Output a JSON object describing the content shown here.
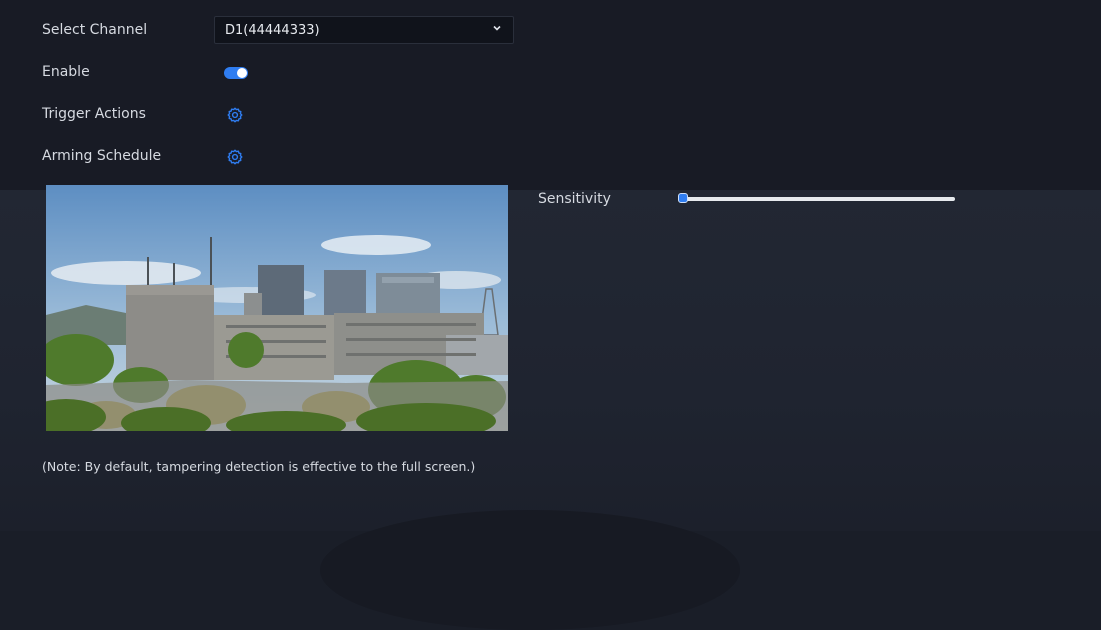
{
  "form": {
    "select_channel_label": "Select Channel",
    "channel_value": "D1(44444333)",
    "enable_label": "Enable",
    "enable_on": true,
    "trigger_actions_label": "Trigger Actions",
    "arming_schedule_label": "Arming Schedule"
  },
  "preview": {
    "image": "camera-live-view-city-buildings"
  },
  "sensitivity": {
    "label": "Sensitivity",
    "value_fraction": 0.01
  },
  "note": "(Note: By default, tampering detection is effective to the full screen.)",
  "icons": {
    "dropdown": "chevron-down-icon",
    "trigger_actions": "gear-icon",
    "arming_schedule": "gear-icon"
  },
  "colors": {
    "accent": "#2f7df1",
    "background_top": "#181b25",
    "background_bottom": "#222733",
    "text": "#d6dae1"
  }
}
